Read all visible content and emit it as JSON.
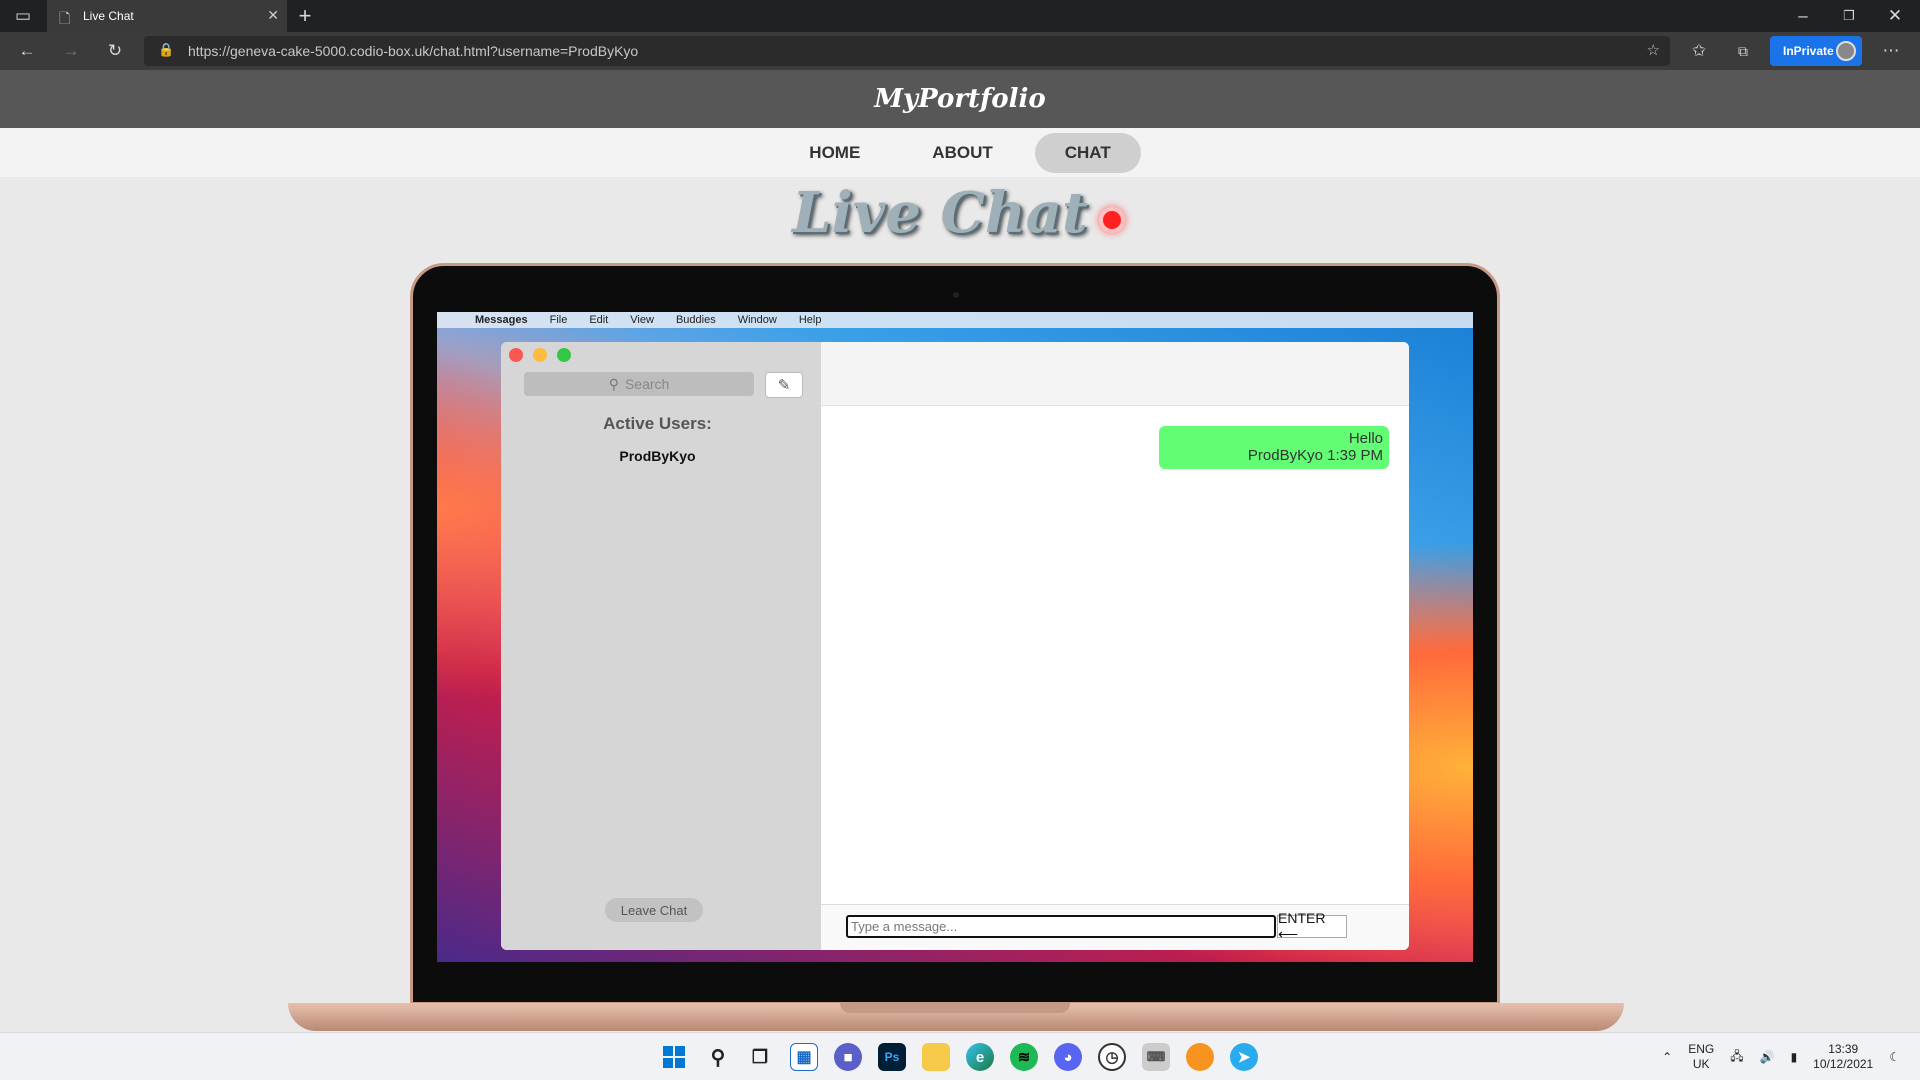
{
  "browser": {
    "tab_title": "Live Chat",
    "url": "https://geneva-cake-5000.codio-box.uk/chat.html?username=ProdByKyo",
    "inprivate_label": "InPrivate"
  },
  "site": {
    "logo": "MyPortfolio",
    "nav": [
      "HOME",
      "ABOUT",
      "CHAT"
    ],
    "active_nav": "CHAT",
    "page_title": "Live Chat"
  },
  "mac_menu": [
    "Messages",
    "File",
    "Edit",
    "View",
    "Buddies",
    "Window",
    "Help"
  ],
  "messages_app": {
    "search_placeholder": "Search",
    "active_users_label": "Active Users:",
    "active_users": [
      "ProdByKyo"
    ],
    "leave_button": "Leave Chat",
    "chat_messages": [
      {
        "text": "Hello",
        "sender": "ProdByKyo",
        "time": "1:39 PM",
        "meta": "ProdByKyo 1:39 PM"
      }
    ],
    "input_placeholder": "Type a message...",
    "enter_button": "ENTER ⟵"
  },
  "taskbar": {
    "lang_top": "ENG",
    "lang_bottom": "UK",
    "time": "13:39",
    "date": "10/12/2021",
    "apps": [
      "windows-start-icon",
      "search-icon",
      "task-view-icon",
      "widgets-icon",
      "teams-chat-icon",
      "photoshop-icon",
      "file-explorer-icon",
      "edge-icon",
      "spotify-icon",
      "discord-icon",
      "clock-icon",
      "keyboard-icon",
      "fl-studio-icon",
      "telegram-icon"
    ]
  },
  "colors": {
    "accent_green": "#63fd75",
    "live_dot": "#ff2020",
    "header_bg": "#575757"
  }
}
